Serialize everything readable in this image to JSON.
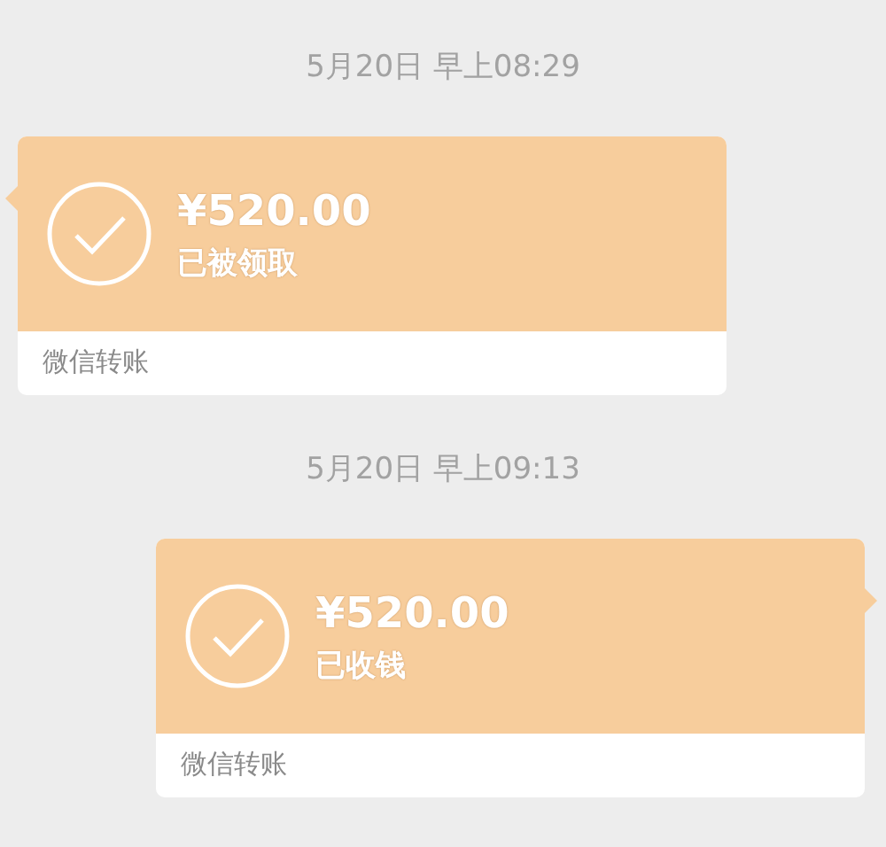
{
  "messages": [
    {
      "timestamp": "5月20日 早上08:29",
      "kind": "received",
      "amount": "¥520.00",
      "status": "已被领取",
      "footer": "微信转账"
    },
    {
      "timestamp": "5月20日 早上09:13",
      "kind": "sent",
      "amount": "¥520.00",
      "status": "已收钱",
      "footer": "微信转账"
    }
  ]
}
